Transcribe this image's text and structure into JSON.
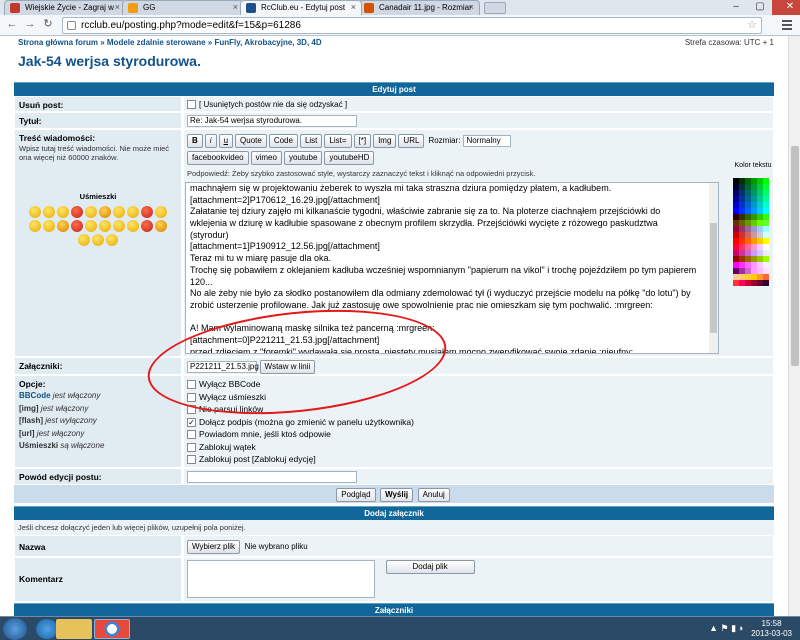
{
  "browser": {
    "tabs": [
      {
        "label": "Wiejskie Życie - Zagraj w",
        "color": "#c0392b",
        "active": false
      },
      {
        "label": "GG",
        "color": "#f39c12",
        "active": false
      },
      {
        "label": "RcClub.eu - Edytuj post",
        "color": "#1f4e8c",
        "active": true
      },
      {
        "label": "Canadair 11.jpg - Rozmiar",
        "color": "#d35400",
        "active": false
      }
    ],
    "url": "rcclub.eu/posting.php?mode=edit&f=15&p=61286"
  },
  "page": {
    "breadcrumb": "Strona główna forum » Modele zdalnie sterowane » FunFly, Akrobacyjne, 3D, 4D",
    "timezone": "Strefa czasowa: UTC + 1",
    "title": "Jak-54 werjsa styrodurowa."
  },
  "form": {
    "header": "Edytuj post",
    "delete_label": "Usuń post:",
    "delete_note": "[ Usuniętych postów nie da się odzyskać ]",
    "subject_label": "Tytuł:",
    "subject_value": "Re: Jak-54 werjsa styrodurowa.",
    "message_label": "Treść wiadomości:",
    "message_sub": "Wpisz tutaj treść wiadomości. Nie może mieć ona więcej niż 60000 znaków.",
    "smileys_label": "Uśmieszki",
    "bbcode_buttons": [
      "B",
      "i",
      "u",
      "Quote",
      "Code",
      "List",
      "List=",
      "[*]",
      "Img",
      "URL"
    ],
    "font_size_label": "Rozmiar:",
    "font_size_value": "Normalny",
    "media_buttons": [
      "facebookvideo",
      "vimeo",
      "youtube",
      "youtubeHD"
    ],
    "hint": "Podpowiedź: Żeby szybko zastosować style, wystarczy zaznaczyć tekst i kliknąć na odpowiedni przycisk.",
    "color_label": "Kolor tekstu",
    "message_lines": [
      "machnąłem się w projektowaniu żeberek to wyszła mi taka straszna dziura pomiędzy płatem, a kadłubem.",
      "[attachment=2]P170612_16.29.jpg[/attachment]",
      "Załatanie tej dziury zajęło mi kilkanaście tygodni, właściwie zabranie się za to. Na ploterze ciachnąłem przejściówki do",
      "wklejenia w dziurę w kadłubie spasowane z obecnym profilem skrzydła. Przejściówki wycięte z różowego paskudztwa",
      "(styrodur)",
      "[attachment=1]P190912_12.56.jpg[/attachment]",
      "Teraz mi tu w miarę pasuje dla oka.",
      "Trochę się pobawiłem z oklejaniem kadłuba wcześniej wspomnianym \"papierum na vikol\" i trochę pojeździłem po tym papierem",
      "120...",
      "No ale żeby nie było za słodko postanowiłem dla odmiany zdemolować tył (i wyduczyć przejście modelu na półkę \"do lotu\") by",
      "zrobić usterzenie profilowane. Jak już zastosuję owe spowolnienie prac nie omieszkam się tym pochwalić. :mrgreen:",
      "",
      "A! Mam wylaminowaną maskę silnika też pancerną :mrgreen:",
      "[attachment=0]P221211_21.53.jpg[/attachment]",
      "przed zdjęciem z \"foremki\" wydawała się prosta, niestety musiałem mocno zweryfikować swoje zdanie :nieufny:"
    ],
    "attachments_label": "Załączniki:",
    "attachment_value": "P221211_21.53.jpg",
    "insert_inline": "Wstaw w linii",
    "options_label": "Opcje:",
    "option_notes": [
      {
        "name": "BBCode",
        "state": "jest włączony"
      },
      {
        "name": "[img]",
        "state": "jest włączony"
      },
      {
        "name": "[flash]",
        "state": "jest wyłączony"
      },
      {
        "name": "[url]",
        "state": "jest włączony"
      },
      {
        "name": "Uśmieszki",
        "state": "są włączone"
      }
    ],
    "checkboxes": [
      {
        "label": "Wyłącz BBCode",
        "checked": false
      },
      {
        "label": "Wyłącz uśmieszki",
        "checked": false
      },
      {
        "label": "Nie parsuj linków",
        "checked": false
      },
      {
        "label": "Dołącz podpis (można go zmienić w panelu użytkownika)",
        "checked": true
      },
      {
        "label": "Powiadom mnie, jeśli ktoś odpowie",
        "checked": false
      },
      {
        "label": "Zablokuj wątek",
        "checked": false
      },
      {
        "label": "Zablokuj post [Zablokuj edycję]",
        "checked": false
      }
    ],
    "reason_label": "Powód edycji postu:",
    "preview_button": "Podgląd",
    "submit_button": "Wyślij",
    "cancel_button": "Anuluj"
  },
  "attach": {
    "header": "Dodaj załącznik",
    "intro": "Jeśli chcesz dołączyć jeden lub więcej plików, uzupełnij pola poniżej.",
    "name_label": "Nazwa",
    "choose_button": "Wybierz plik",
    "no_file": "Nie wybrano pliku",
    "comment_label": "Komentarz",
    "add_button": "Dodaj plik",
    "footer_header": "Załączniki"
  },
  "taskbar": {
    "time": "15:58",
    "date": "2013-03-03"
  },
  "colors": {
    "accent": "#12679a",
    "label_bg": "#e1ebf2",
    "field_bg": "#ecf3f7",
    "annotation": "#e31a1a"
  }
}
